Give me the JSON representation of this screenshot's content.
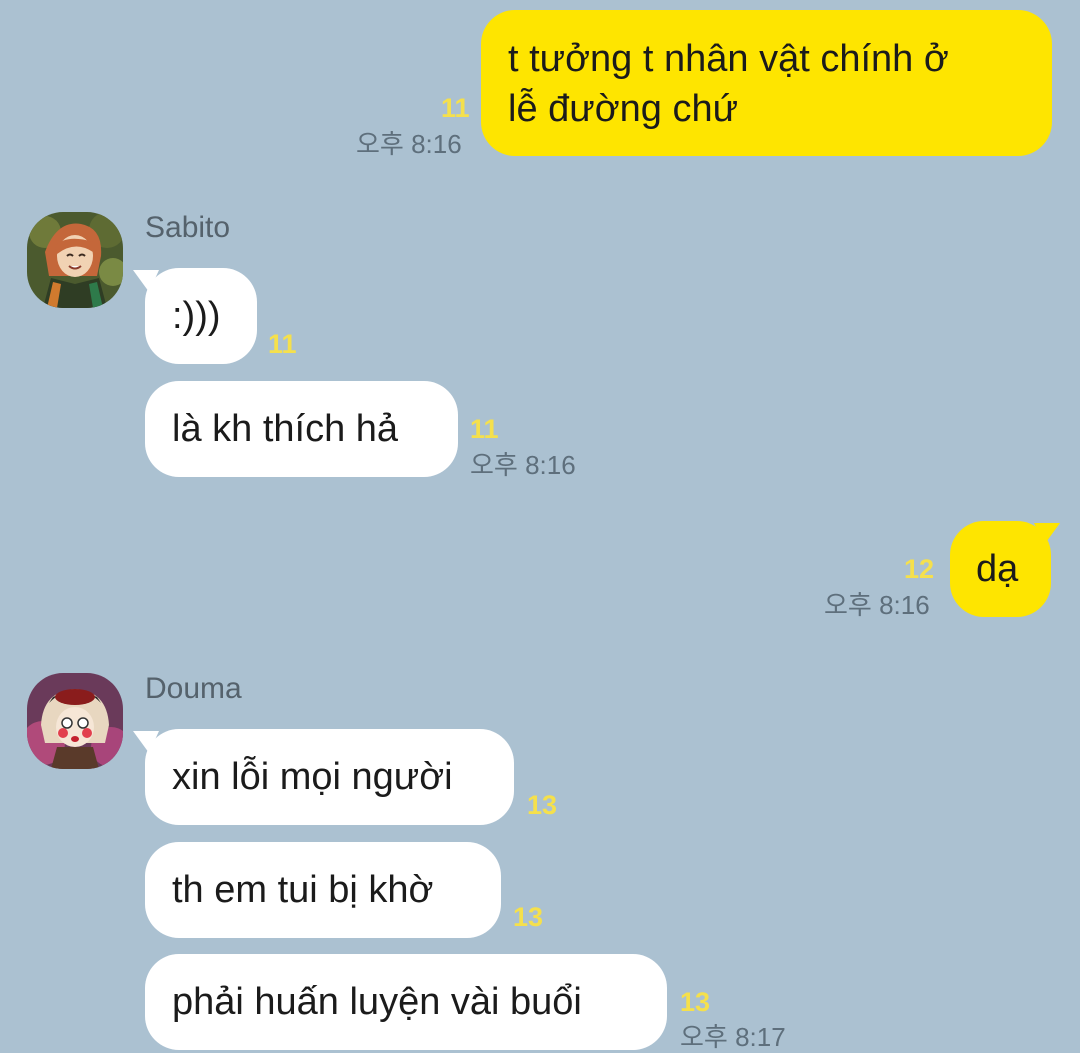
{
  "colors": {
    "background": "#abc1d1",
    "my_bubble": "#fee500",
    "other_bubble": "#ffffff",
    "unread_count": "#f5e04c",
    "timestamp": "#5e6f7c"
  },
  "messages": [
    {
      "from": "me",
      "text_line1": "t tưởng t nhân vật chính ở",
      "text_line2": "lễ đường chứ",
      "unread": "11",
      "time": "오후 8:16"
    },
    {
      "from": "Sabito",
      "sender_name": "Sabito",
      "avatar_icon": "sabito-avatar-icon",
      "bubbles": [
        {
          "text": ":)))",
          "unread": "11"
        },
        {
          "text": "là kh thích hả",
          "unread": "11"
        }
      ],
      "time": "오후 8:16"
    },
    {
      "from": "me",
      "text": "dạ",
      "unread": "12",
      "time": "오후 8:16"
    },
    {
      "from": "Douma",
      "sender_name": "Douma",
      "avatar_icon": "douma-avatar-icon",
      "bubbles": [
        {
          "text": "xin lỗi mọi người",
          "unread": "13"
        },
        {
          "text": "th em tui bị khờ",
          "unread": "13"
        },
        {
          "text": "phải huấn luyện vài buổi",
          "unread": "13"
        }
      ],
      "time": "오후 8:17"
    }
  ]
}
